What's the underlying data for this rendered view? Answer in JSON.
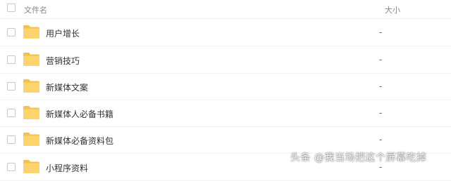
{
  "colors": {
    "folder": "#fcd46b",
    "folder_tab": "#f5c14e",
    "header_text": "#888888"
  },
  "header": {
    "name_label": "文件名",
    "size_label": "大小"
  },
  "files": [
    {
      "icon": "folder-icon",
      "name": "用户增长",
      "size": "-"
    },
    {
      "icon": "folder-icon",
      "name": "营销技巧",
      "size": "-"
    },
    {
      "icon": "folder-icon",
      "name": "新媒体文案",
      "size": "-"
    },
    {
      "icon": "folder-icon",
      "name": "新媒体人必备书籍",
      "size": "-"
    },
    {
      "icon": "folder-icon",
      "name": "新媒体必备资料包",
      "size": "-"
    },
    {
      "icon": "folder-icon",
      "name": "小程序资料",
      "size": "-"
    }
  ],
  "watermark": "头条 @我当场把这个屏幕吃掉"
}
